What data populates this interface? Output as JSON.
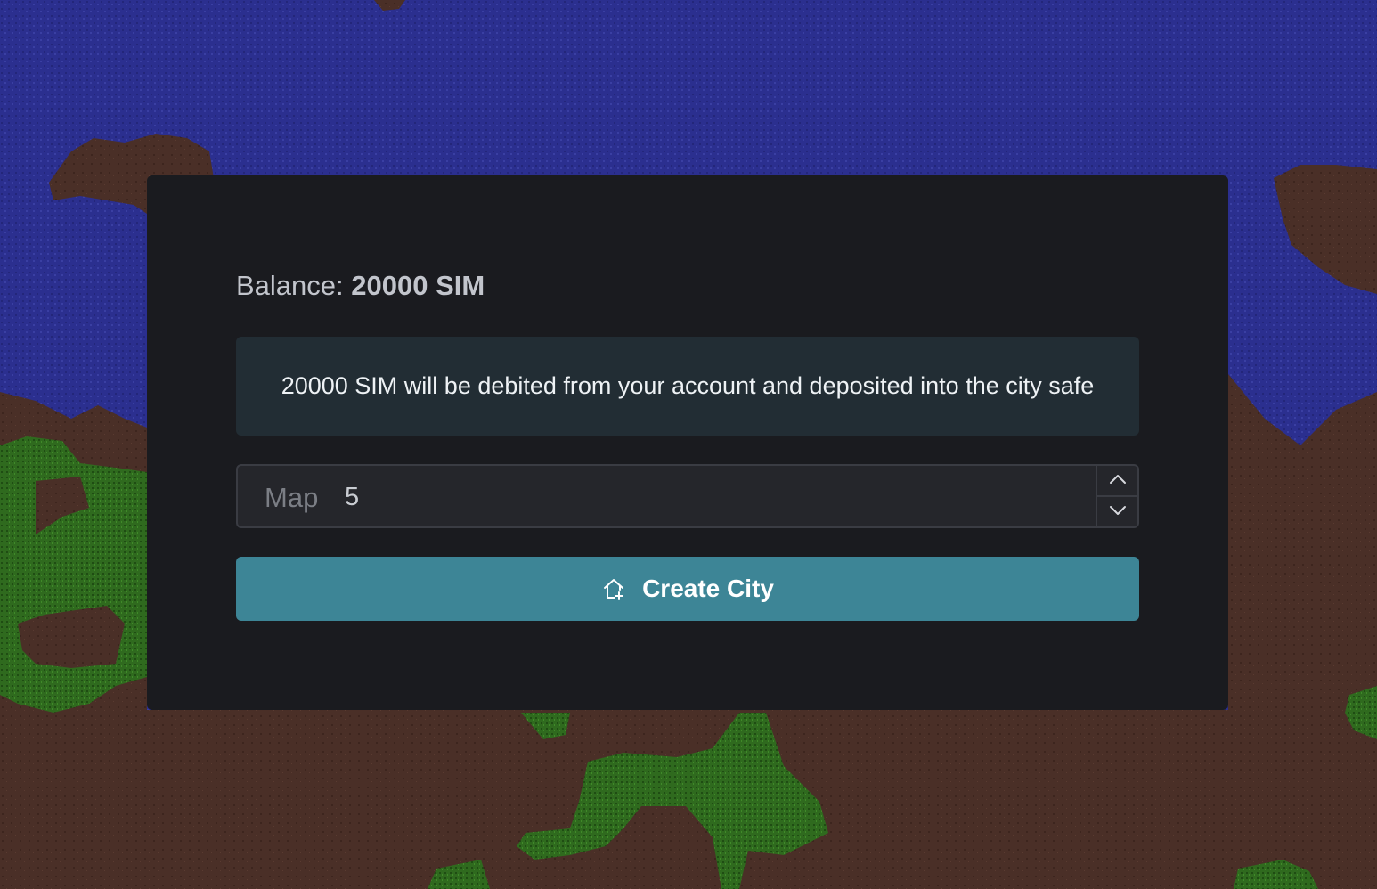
{
  "balance": {
    "label": "Balance:",
    "amount": "20000 SIM"
  },
  "notice": {
    "text": "20000 SIM will be debited from your account and deposited into the city safe"
  },
  "map_input": {
    "prefix": "Map",
    "value": "5",
    "increment_icon": "chevron-up-icon",
    "decrement_icon": "chevron-down-icon"
  },
  "create_button": {
    "label": "Create City",
    "icon": "home-plus-icon"
  },
  "colors": {
    "water": "#2b2f8f",
    "dirt": "#4a2f27",
    "grass": "#2f6a1e",
    "panel": "#1a1b1f",
    "notice_bg": "#222d34",
    "button": "#3d8596"
  }
}
